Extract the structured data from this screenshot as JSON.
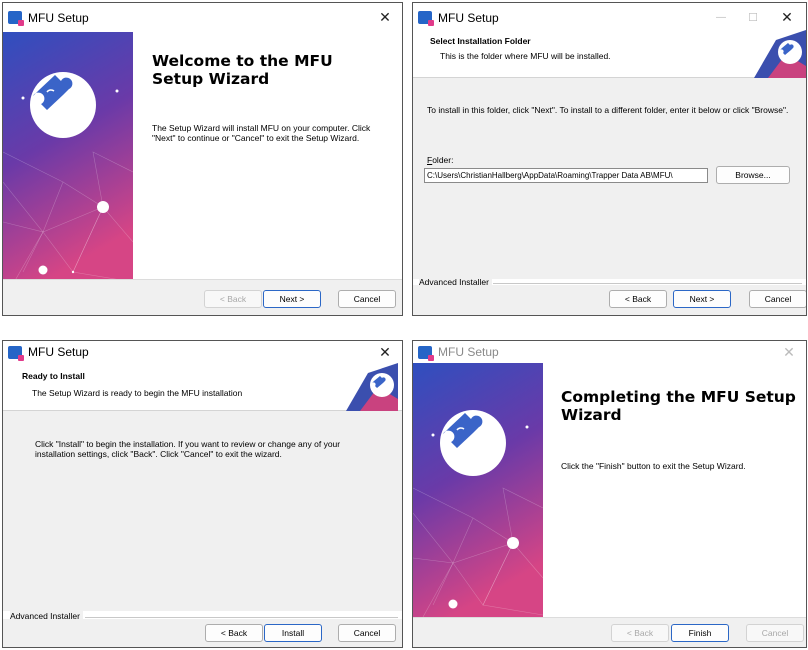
{
  "colors": {
    "brand_blue": "#2b5fc1",
    "brand_pink": "#d9407f",
    "accent_border": "#2b67c6"
  },
  "icons": [
    "app-icon",
    "minimize-icon",
    "maximize-icon",
    "close-icon",
    "puzzle-logo-icon"
  ],
  "window_title": "MFU Setup",
  "close_glyph": "✕",
  "minimize_glyph": "—",
  "maximize_glyph": "☐",
  "welcome": {
    "title": "Welcome to the MFU Setup Wizard",
    "body": "The Setup Wizard will install MFU on your computer.  Click \"Next\" to continue or \"Cancel\" to exit the Setup Wizard.",
    "back": "< Back",
    "next": "Next >",
    "cancel": "Cancel"
  },
  "folder": {
    "header_title": "Select Installation Folder",
    "header_sub": "This is the folder where MFU will be installed.",
    "body": "To install in this folder, click \"Next\". To install to a different folder, enter it below or click \"Browse\".",
    "folder_label_ul": "F",
    "folder_label_rest": "older:",
    "folder_value": "C:\\Users\\ChristianHallberg\\AppData\\Roaming\\Trapper Data AB\\MFU\\",
    "browse": "Browse...",
    "advanced": "Advanced Installer",
    "back": "< Back",
    "next": "Next >",
    "cancel": "Cancel"
  },
  "ready": {
    "header_title": "Ready to Install",
    "header_sub": "The Setup Wizard is ready to begin the MFU installation",
    "body": "Click \"Install\" to begin the installation.  If you want to review or change any of your installation settings, click \"Back\".  Click \"Cancel\" to exit the wizard.",
    "advanced": "Advanced Installer",
    "back": "< Back",
    "install": "Install",
    "cancel": "Cancel"
  },
  "complete": {
    "title": "Completing the MFU Setup Wizard",
    "body": "Click the \"Finish\" button to exit the Setup Wizard.",
    "back": "< Back",
    "finish": "Finish",
    "cancel": "Cancel"
  }
}
